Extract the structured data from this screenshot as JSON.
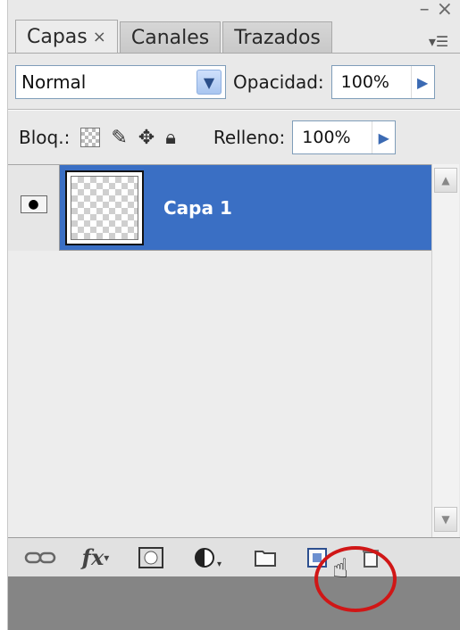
{
  "window": {
    "minimize": "–",
    "close": "×"
  },
  "tabs": [
    {
      "label": "Capas",
      "close": "×"
    },
    {
      "label": "Canales"
    },
    {
      "label": "Trazados"
    }
  ],
  "panel_menu_icon": "panel-menu-icon",
  "blend": {
    "mode": "Normal",
    "opacity_label": "Opacidad:",
    "opacity_value": "100%"
  },
  "lock": {
    "label": "Bloq.:",
    "fill_label": "Relleno:",
    "fill_value": "100%"
  },
  "layers": [
    {
      "name": "Capa 1",
      "visible": true,
      "selected": true
    }
  ],
  "toolbar_icons": [
    "link-layers-icon",
    "fx-icon",
    "layer-mask-icon",
    "adjustment-layer-icon",
    "new-group-icon",
    "new-layer-icon",
    "delete-layer-icon"
  ],
  "colors": {
    "selection": "#3a6fc4",
    "highlight_circle": "#d01616",
    "panel_bg": "#e9e9e9"
  }
}
